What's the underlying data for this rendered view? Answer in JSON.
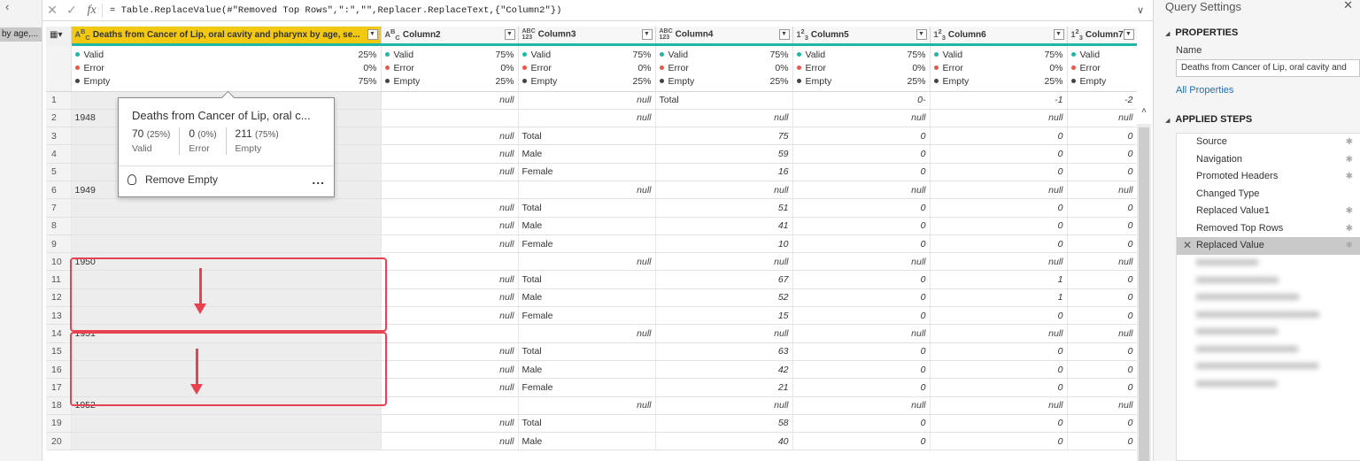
{
  "left_panel": {
    "query_label": "by age,..."
  },
  "formula": {
    "text": "= Table.ReplaceValue(#\"Removed Top Rows\",\":\",\"\",Replacer.ReplaceText,{\"Column2\"})"
  },
  "columns": [
    {
      "type": "ABC",
      "name": "Deaths from Cancer of Lip, oral cavity and pharynx by age, se...",
      "valid": "25%",
      "error": "0%",
      "empty": "75%"
    },
    {
      "type": "ABC",
      "name": "Column2",
      "valid": "75%",
      "error": "0%",
      "empty": "25%"
    },
    {
      "type": "ABC123",
      "name": "Column3",
      "valid": "75%",
      "error": "0%",
      "empty": "25%"
    },
    {
      "type": "ABC123",
      "name": "Column4",
      "valid": "75%",
      "error": "0%",
      "empty": "25%"
    },
    {
      "type": "123",
      "name": "Column5",
      "valid": "75%",
      "error": "0%",
      "empty": "25%"
    },
    {
      "type": "123",
      "name": "Column6",
      "valid": "75%",
      "error": "0%",
      "empty": "25%"
    },
    {
      "type": "123",
      "name": "Column7",
      "valid": "",
      "error": "",
      "empty": ""
    }
  ],
  "quality_labels": {
    "valid": "Valid",
    "error": "Error",
    "empty": "Empty"
  },
  "rows": [
    [
      "1",
      "",
      "null",
      "null",
      "Total",
      "0-",
      "-1",
      "-2"
    ],
    [
      "2",
      "1948",
      "",
      "null",
      "null",
      "null",
      "null",
      "null"
    ],
    [
      "3",
      "",
      "null",
      "Total",
      "75",
      "0",
      "0",
      "0"
    ],
    [
      "4",
      "",
      "null",
      "Male",
      "59",
      "0",
      "0",
      "0"
    ],
    [
      "5",
      "",
      "null",
      "Female",
      "16",
      "0",
      "0",
      "0"
    ],
    [
      "6",
      "1949",
      "",
      "null",
      "null",
      "null",
      "null",
      "null"
    ],
    [
      "7",
      "",
      "null",
      "Total",
      "51",
      "0",
      "0",
      "0"
    ],
    [
      "8",
      "",
      "null",
      "Male",
      "41",
      "0",
      "0",
      "0"
    ],
    [
      "9",
      "",
      "null",
      "Female",
      "10",
      "0",
      "0",
      "0"
    ],
    [
      "10",
      "1950",
      "",
      "null",
      "null",
      "null",
      "null",
      "null"
    ],
    [
      "11",
      "",
      "null",
      "Total",
      "67",
      "0",
      "1",
      "0"
    ],
    [
      "12",
      "",
      "null",
      "Male",
      "52",
      "0",
      "1",
      "0"
    ],
    [
      "13",
      "",
      "null",
      "Female",
      "15",
      "0",
      "0",
      "0"
    ],
    [
      "14",
      "1951",
      "",
      "null",
      "null",
      "null",
      "null",
      "null"
    ],
    [
      "15",
      "",
      "null",
      "Total",
      "63",
      "0",
      "0",
      "0"
    ],
    [
      "16",
      "",
      "null",
      "Male",
      "42",
      "0",
      "0",
      "0"
    ],
    [
      "17",
      "",
      "null",
      "Female",
      "21",
      "0",
      "0",
      "0"
    ],
    [
      "18",
      "1952",
      "",
      "null",
      "null",
      "null",
      "null",
      "null"
    ],
    [
      "19",
      "",
      "null",
      "Total",
      "58",
      "0",
      "0",
      "0"
    ],
    [
      "20",
      "",
      "null",
      "Male",
      "40",
      "0",
      "0",
      "0"
    ]
  ],
  "tooltip": {
    "title": "Deaths from Cancer of Lip, oral c...",
    "valid_count": "70",
    "valid_pct": "(25%)",
    "valid_label": "Valid",
    "error_count": "0",
    "error_pct": "(0%)",
    "error_label": "Error",
    "empty_count": "211",
    "empty_pct": "(75%)",
    "empty_label": "Empty",
    "action": "Remove Empty",
    "more": "..."
  },
  "query_settings": {
    "title": "Query Settings",
    "properties_header": "PROPERTIES",
    "name_label": "Name",
    "name_value": "Deaths from Cancer of Lip, oral cavity and",
    "all_properties": "All Properties",
    "applied_steps_header": "APPLIED STEPS",
    "steps": [
      {
        "label": "Source",
        "gear": true
      },
      {
        "label": "Navigation",
        "gear": true
      },
      {
        "label": "Promoted Headers",
        "gear": true
      },
      {
        "label": "Changed Type",
        "gear": false
      },
      {
        "label": "Replaced Value1",
        "gear": true
      },
      {
        "label": "Removed Top Rows",
        "gear": true
      },
      {
        "label": "Replaced Value",
        "gear": true,
        "active": true
      }
    ]
  },
  "colors": {
    "selected_header": "#f2c811",
    "valid": "#1fb7a8",
    "error": "#e8584a",
    "highlight": "#e8414f",
    "link": "#1f6fb6"
  }
}
